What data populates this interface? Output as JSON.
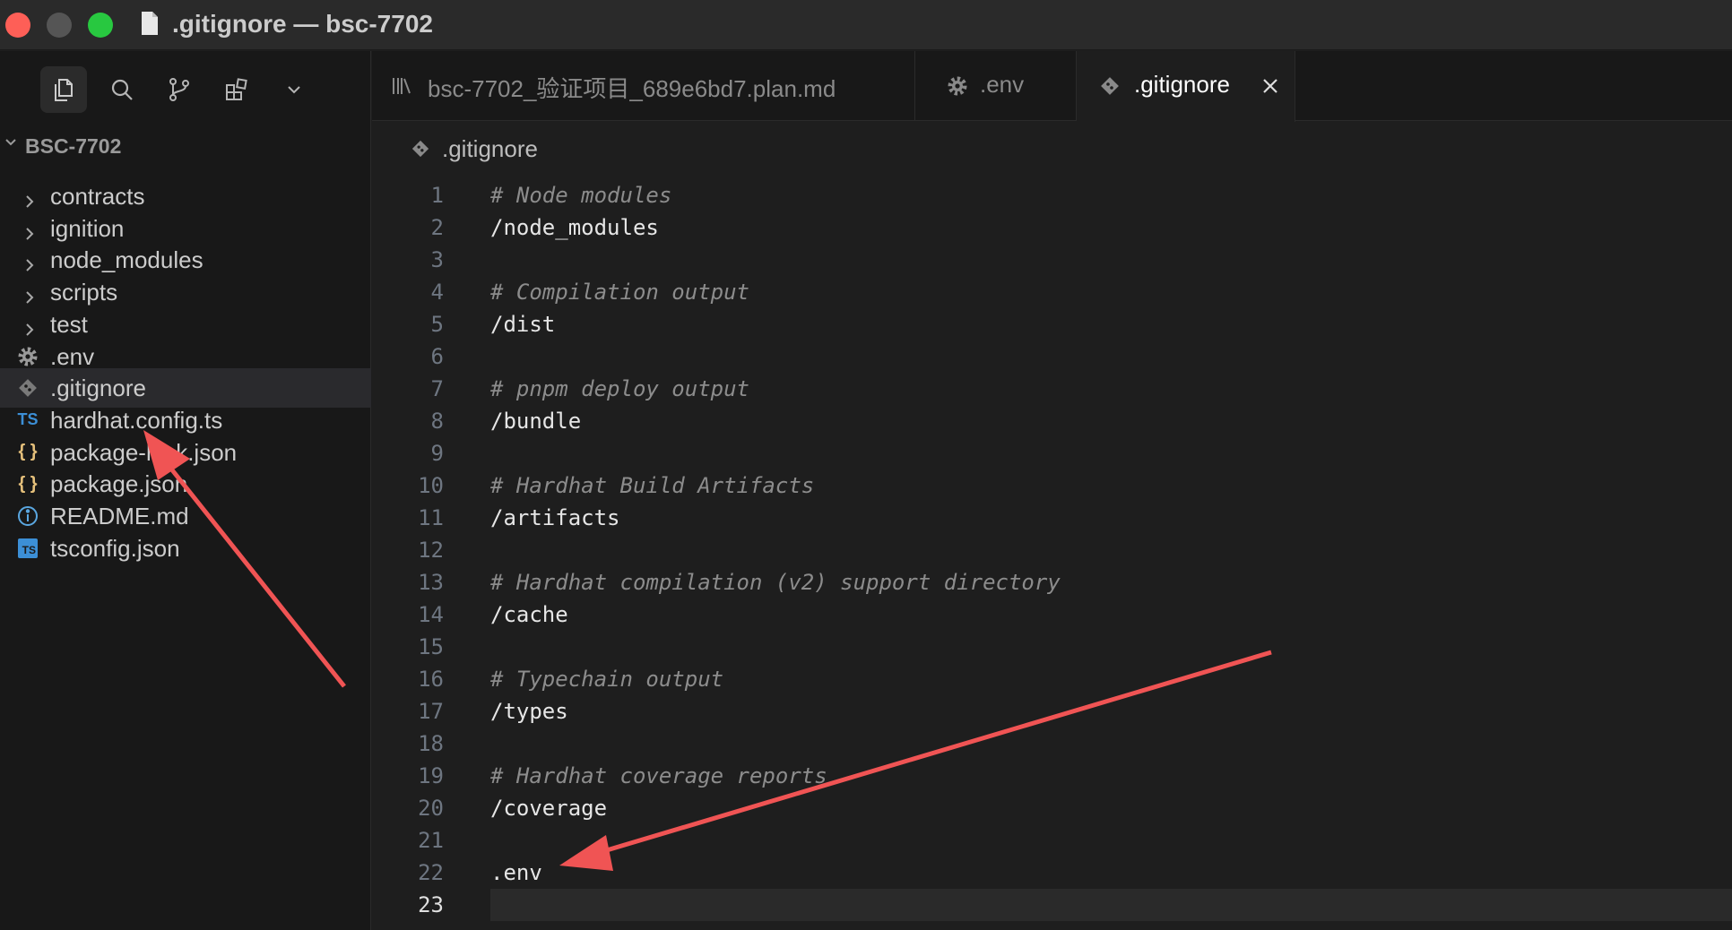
{
  "window": {
    "title": ".gitignore — bsc-7702"
  },
  "explorer": {
    "section_title": "BSC-7702",
    "items": [
      {
        "label": "contracts",
        "kind": "folder",
        "icon": "chevron-right-icon"
      },
      {
        "label": "ignition",
        "kind": "folder",
        "icon": "chevron-right-icon"
      },
      {
        "label": "node_modules",
        "kind": "folder",
        "icon": "chevron-right-icon"
      },
      {
        "label": "scripts",
        "kind": "folder",
        "icon": "chevron-right-icon"
      },
      {
        "label": "test",
        "kind": "folder",
        "icon": "chevron-right-icon"
      },
      {
        "label": ".env",
        "kind": "file",
        "icon": "gear-icon"
      },
      {
        "label": ".gitignore",
        "kind": "file",
        "icon": "git-icon",
        "selected": true
      },
      {
        "label": "hardhat.config.ts",
        "kind": "file",
        "icon": "typescript-icon",
        "badge": "TS"
      },
      {
        "label": "package-lock.json",
        "kind": "file",
        "icon": "json-icon",
        "badge": "{ }"
      },
      {
        "label": "package.json",
        "kind": "file",
        "icon": "json-icon",
        "badge": "{ }"
      },
      {
        "label": "README.md",
        "kind": "file",
        "icon": "info-icon"
      },
      {
        "label": "tsconfig.json",
        "kind": "file",
        "icon": "tsconfig-icon",
        "badge": "TS"
      }
    ]
  },
  "tabs": [
    {
      "label": "bsc-7702_验证项目_689e6bd7.plan.md",
      "icon": "library-icon",
      "active": false
    },
    {
      "label": ".env",
      "icon": "gear-icon",
      "active": false
    },
    {
      "label": ".gitignore",
      "icon": "git-icon",
      "active": true
    }
  ],
  "breadcrumb": {
    "label": ".gitignore"
  },
  "editor": {
    "current_line": 23,
    "lines": [
      {
        "n": "1",
        "text": "# Node modules",
        "comment": true
      },
      {
        "n": "2",
        "text": "/node_modules",
        "comment": false
      },
      {
        "n": "3",
        "text": "",
        "comment": false
      },
      {
        "n": "4",
        "text": "# Compilation output",
        "comment": true
      },
      {
        "n": "5",
        "text": "/dist",
        "comment": false
      },
      {
        "n": "6",
        "text": "",
        "comment": false
      },
      {
        "n": "7",
        "text": "# pnpm deploy output",
        "comment": true
      },
      {
        "n": "8",
        "text": "/bundle",
        "comment": false
      },
      {
        "n": "9",
        "text": "",
        "comment": false
      },
      {
        "n": "10",
        "text": "# Hardhat Build Artifacts",
        "comment": true
      },
      {
        "n": "11",
        "text": "/artifacts",
        "comment": false
      },
      {
        "n": "12",
        "text": "",
        "comment": false
      },
      {
        "n": "13",
        "text": "# Hardhat compilation (v2) support directory",
        "comment": true
      },
      {
        "n": "14",
        "text": "/cache",
        "comment": false
      },
      {
        "n": "15",
        "text": "",
        "comment": false
      },
      {
        "n": "16",
        "text": "# Typechain output",
        "comment": true
      },
      {
        "n": "17",
        "text": "/types",
        "comment": false
      },
      {
        "n": "18",
        "text": "",
        "comment": false
      },
      {
        "n": "19",
        "text": "# Hardhat coverage reports",
        "comment": true
      },
      {
        "n": "20",
        "text": "/coverage",
        "comment": false
      },
      {
        "n": "21",
        "text": "",
        "comment": false
      },
      {
        "n": "22",
        "text": ".env",
        "comment": false
      },
      {
        "n": "23",
        "text": "",
        "comment": false
      }
    ]
  },
  "colors": {
    "arrow": "#f05454",
    "traffic_red": "#fe5f57",
    "traffic_green": "#28c840",
    "json_icon": "#e5c07b",
    "ts_icon": "#3c8fd6"
  }
}
